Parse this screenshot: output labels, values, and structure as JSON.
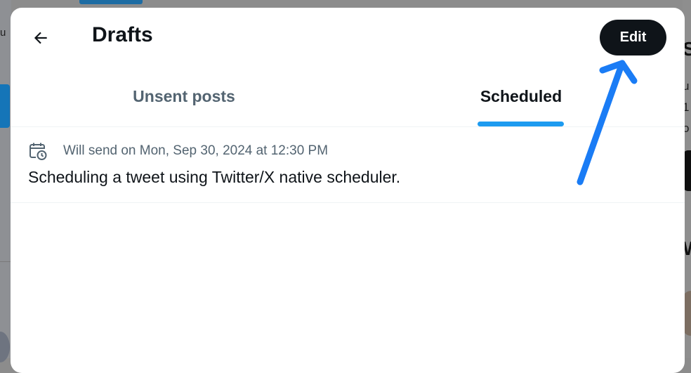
{
  "background": {
    "left_fragment_text": "u",
    "right_heading_1": "S",
    "right_lines": [
      "u",
      "1",
      "o"
    ],
    "right_heading_2": "W"
  },
  "header": {
    "back_icon": "arrow-left-icon",
    "title": "Drafts",
    "edit_label": "Edit"
  },
  "tabs": [
    {
      "label": "Unsent posts",
      "active": false
    },
    {
      "label": "Scheduled",
      "active": true
    }
  ],
  "scheduled_items": [
    {
      "icon": "calendar-clock-icon",
      "schedule_text": "Will send on Mon, Sep 30, 2024 at 12:30 PM",
      "text": "Scheduling a tweet using Twitter/X native scheduler."
    }
  ],
  "colors": {
    "accent": "#1d9bf0",
    "primary_text": "#0f1419",
    "secondary_text": "#536471",
    "annotation_arrow": "#1a7cf5"
  }
}
